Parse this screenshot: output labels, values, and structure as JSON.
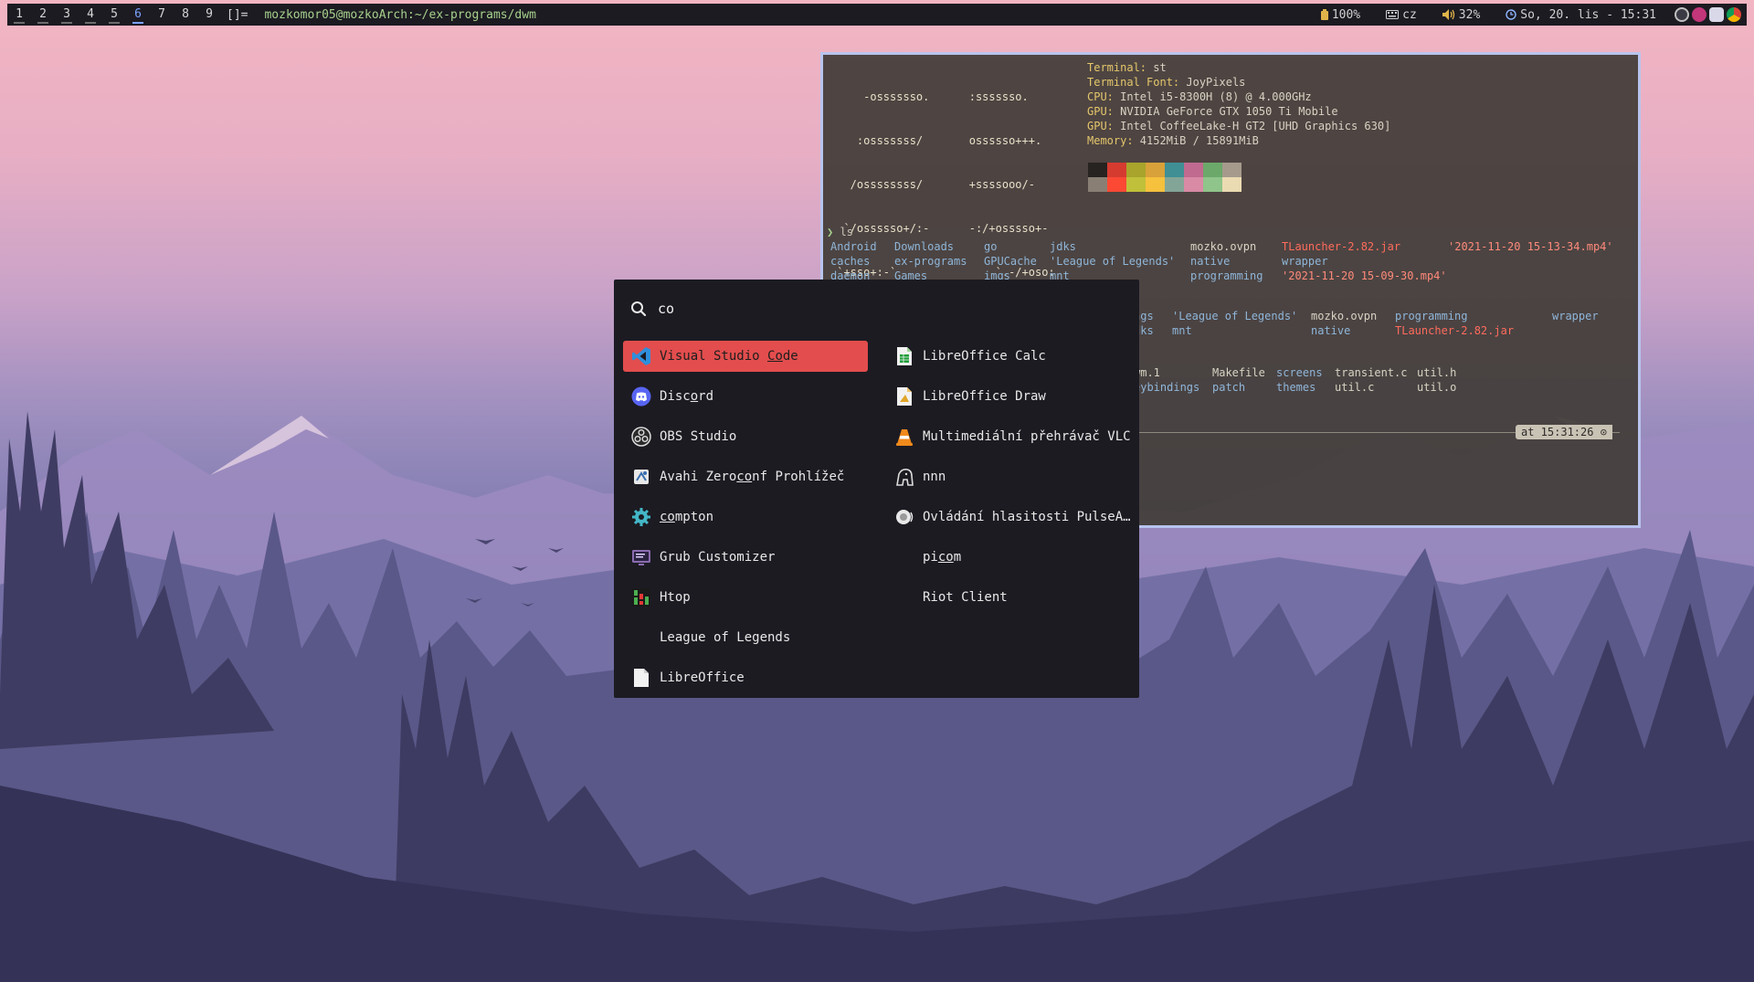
{
  "bar": {
    "tags": [
      "1",
      "2",
      "3",
      "4",
      "5",
      "6",
      "7",
      "8",
      "9"
    ],
    "active_tag": "6",
    "layout": "[]=",
    "window_title": "mozkomor05@mozkoArch:~/ex-programs/dwm",
    "battery": "100%",
    "keyboard": "cz",
    "volume": "32%",
    "datetime": "So, 20. lis - 15:31"
  },
  "colors": {
    "bar_bg": "#1c1b22",
    "accent": "#e34d4d",
    "terminal_border": "#b8c4ee",
    "title_green": "#a6d18c"
  },
  "terminal": {
    "logo_lines": [
      "     -osssssso.      :sssssso.",
      "    :osssssss/       ossssso+++.",
      "   /ossssssss/       +ssssooo/-",
      "  `/ossssso+/:-      -:/+osssso+-",
      " `+sso+:-`               `.-/+oso:",
      "`++:.                         `-/+/",
      ".`                               `/"
    ],
    "info": [
      {
        "key": "Terminal",
        "val": "st"
      },
      {
        "key": "Terminal Font",
        "val": "JoyPixels"
      },
      {
        "key": "CPU",
        "val": "Intel i5-8300H (8) @ 4.000GHz"
      },
      {
        "key": "GPU",
        "val": "NVIDIA GeForce GTX 1050 Ti Mobile"
      },
      {
        "key": "GPU",
        "val": "Intel CoffeeLake-H GT2 [UHD Graphics 630]"
      },
      {
        "key": "Memory",
        "val": "4152MiB / 15891MiB"
      }
    ],
    "palette_top": [
      "#262321",
      "#d63b30",
      "#a9a42b",
      "#d8a13a",
      "#3f8f95",
      "#c06a8f",
      "#6ca86a",
      "#a59a8c"
    ],
    "palette_bottom": [
      "#8a7f74",
      "#fb4934",
      "#c0c03a",
      "#f6c13c",
      "#83a598",
      "#d98aa5",
      "#8fc48a",
      "#ebdbb2"
    ],
    "prompt_cmd": "ls",
    "ls_rows": [
      [
        {
          "t": "Android",
          "c": "ls-dir"
        },
        {
          "t": "Downloads",
          "c": "ls-dir"
        },
        {
          "t": "go",
          "c": "ls-dir"
        },
        {
          "t": "jdks",
          "c": "ls-dir"
        },
        {
          "t": "mozko.ovpn",
          "c": "ls-file"
        },
        {
          "t": "TLauncher-2.82.jar",
          "c": "ls-exec"
        },
        {
          "t": "'2021-11-20 15-13-34.mp4'",
          "c": "ls-str"
        }
      ],
      [
        {
          "t": "caches",
          "c": "ls-dir"
        },
        {
          "t": "ex-programs",
          "c": "ls-dir"
        },
        {
          "t": "GPUCache",
          "c": "ls-dir"
        },
        {
          "t": "'League of Legends'",
          "c": "ls-dir"
        },
        {
          "t": "native",
          "c": "ls-dir"
        },
        {
          "t": "wrapper",
          "c": "ls-dir"
        }
      ],
      [
        {
          "t": "daemon",
          "c": "ls-dir"
        },
        {
          "t": "Games",
          "c": "ls-dir"
        },
        {
          "t": "imgs",
          "c": "ls-dir"
        },
        {
          "t": "mnt",
          "c": "ls-dir"
        },
        {
          "t": "programming",
          "c": "ls-dir"
        },
        {
          "t": "'2021-11-20 15-09-30.mp4'",
          "c": "ls-str"
        }
      ]
    ],
    "ls2_rows": [
      [
        {
          "t": "ngs",
          "c": "ls-dir"
        },
        {
          "t": "'League of Legends'",
          "c": "ls-dir"
        },
        {
          "t": "mozko.ovpn",
          "c": "ls-file"
        },
        {
          "t": "programming",
          "c": "ls-dir"
        },
        {
          "t": "wrapper",
          "c": "ls-dir"
        }
      ],
      [
        {
          "t": "dks",
          "c": "ls-dir"
        },
        {
          "t": "mnt",
          "c": "ls-dir"
        },
        {
          "t": "native",
          "c": "ls-dir"
        },
        {
          "t": "TLauncher-2.82.jar",
          "c": "ls-exec"
        }
      ]
    ],
    "ls3_rows": [
      [
        {
          "t": "wm.1",
          "c": "ls-file"
        },
        {
          "t": "Makefile",
          "c": "ls-file"
        },
        {
          "t": "screens",
          "c": "ls-dir"
        },
        {
          "t": "transient.c",
          "c": "ls-file"
        },
        {
          "t": "util.h",
          "c": "ls-file"
        }
      ],
      [
        {
          "t": "eybindings",
          "c": "ls-dir"
        },
        {
          "t": "patch",
          "c": "ls-dir"
        },
        {
          "t": "themes",
          "c": "ls-dir"
        },
        {
          "t": "util.c",
          "c": "ls-file"
        },
        {
          "t": "util.o",
          "c": "ls-file"
        }
      ]
    ],
    "time_badge": "at 15:31:26 ⊙"
  },
  "launcher": {
    "query": "co",
    "items": [
      {
        "name": "Visual Studio Code",
        "pre": "Visual Studio ",
        "match": "Co",
        "post": "de",
        "icon": "vscode-icon",
        "selected": true
      },
      {
        "name": "Discord",
        "pre": "Disc",
        "match": "o",
        "post": "rd",
        "icon": "discord-icon"
      },
      {
        "name": "OBS Studio",
        "pre": "OBS Studio",
        "match": "",
        "post": "",
        "icon": "obs-icon"
      },
      {
        "name": "Avahi Zeroconf Prohlížeč",
        "pre": "Avahi Zero",
        "match": "co",
        "post": "nf Prohlížeč",
        "icon": "avahi-icon"
      },
      {
        "name": "compton",
        "pre": "",
        "match": "co",
        "post": "mpton",
        "icon": "compton-icon"
      },
      {
        "name": "Grub Customizer",
        "pre": "Grub Customizer",
        "match": "",
        "post": "",
        "icon": "grub-icon"
      },
      {
        "name": "Htop",
        "pre": "Htop",
        "match": "",
        "post": "",
        "icon": "htop-icon"
      },
      {
        "name": "League of Legends",
        "pre": "League of Legends",
        "match": "",
        "post": "",
        "icon": ""
      },
      {
        "name": "LibreOffice",
        "pre": "LibreOffice",
        "match": "",
        "post": "",
        "icon": "libreoffice-icon"
      },
      {
        "name": "LibreOffice Calc",
        "pre": "LibreOffice Calc",
        "match": "",
        "post": "",
        "icon": "calc-icon"
      },
      {
        "name": "LibreOffice Draw",
        "pre": "LibreOffice Draw",
        "match": "",
        "post": "",
        "icon": "draw-icon"
      },
      {
        "name": "Multimediální přehrávač VLC",
        "pre": "Multimediální přehrávač VLC",
        "match": "",
        "post": "",
        "icon": "vlc-icon"
      },
      {
        "name": "nnn",
        "pre": "nnn",
        "match": "",
        "post": "",
        "icon": "nnn-icon"
      },
      {
        "name": "Ovládání hlasitosti PulseA…",
        "pre": "Ovládání hlasitosti PulseA…",
        "match": "",
        "post": "",
        "icon": "pulseaudio-icon"
      },
      {
        "name": "picom",
        "pre": "pi",
        "match": "co",
        "post": "m",
        "icon": ""
      },
      {
        "name": "Riot Client",
        "pre": "Riot Client",
        "match": "",
        "post": "",
        "icon": ""
      }
    ]
  }
}
